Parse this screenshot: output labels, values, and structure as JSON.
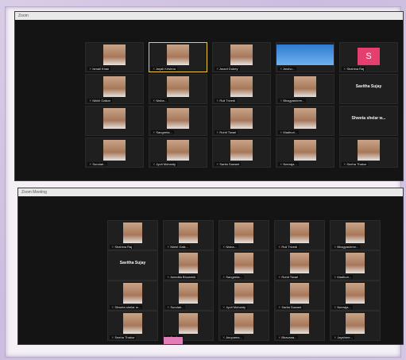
{
  "screens": [
    {
      "title": "Zoom",
      "rows": [
        [
          {
            "name": "Ismail Khan"
          },
          {
            "name": "Anjali Krishna",
            "active": true
          },
          {
            "name": "Anant Dubey"
          },
          {
            "name": "Anshu...",
            "bright": true
          },
          {
            "name": "Shahina Raj",
            "avatar": "S"
          }
        ],
        [
          {
            "name": "Nikhil Gaikar"
          },
          {
            "name": "Nisha..."
          },
          {
            "name": "Ruli Trivedi"
          },
          {
            "name": "Bhagyashree..."
          },
          {
            "name": "",
            "big": "Savitha Sujay"
          }
        ],
        [
          {
            "name": ""
          },
          {
            "name": "Sangeeta..."
          },
          {
            "name": "Rohit Tiwari"
          },
          {
            "name": "Madhuri..."
          },
          {
            "name": "",
            "big": "Shweta shelar w..."
          }
        ],
        [
          {
            "name": "Sundari..."
          },
          {
            "name": "Jyoti Mohanty"
          },
          {
            "name": "Sarita Sawant"
          },
          {
            "name": "Neeraja..."
          },
          {
            "name": "Sneha Thakur"
          }
        ]
      ]
    },
    {
      "title": "Zoom Meeting",
      "rows": [
        [
          {
            "name": "Shahina Raj"
          },
          {
            "name": "Nikhil Gaik..."
          },
          {
            "name": "Nisha..."
          },
          {
            "name": "Ruli Trivedi"
          },
          {
            "name": "Bhagyashree..."
          }
        ],
        [
          {
            "name": "",
            "big": "Savitha Sujay"
          },
          {
            "name": "Anindita Bhowmik"
          },
          {
            "name": "Sangeeta..."
          },
          {
            "name": "Rohit Tiwari"
          },
          {
            "name": "Madhuri..."
          }
        ],
        [
          {
            "name": "Shweta shelar w..."
          },
          {
            "name": "Sundari..."
          },
          {
            "name": "Jyoti Mohanty"
          },
          {
            "name": "Sarita Sawant"
          },
          {
            "name": "Neeraja..."
          }
        ],
        [
          {
            "name": "Sneha Thakur"
          },
          {
            "name": "Sunita..."
          },
          {
            "name": "Anupama..."
          },
          {
            "name": "Bhavana..."
          },
          {
            "name": "Jayshree..."
          }
        ]
      ]
    }
  ]
}
